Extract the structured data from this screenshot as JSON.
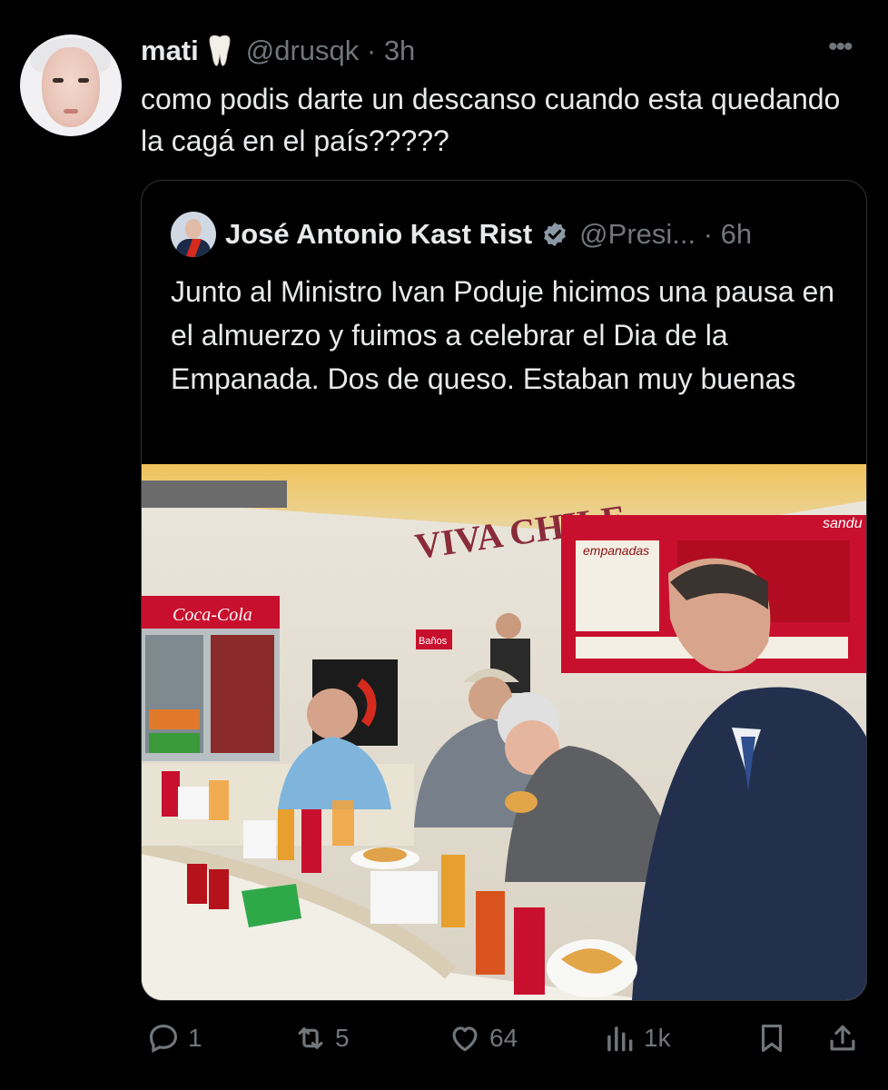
{
  "post": {
    "author_name": "mati",
    "author_emoji_icon": "tooth-icon",
    "handle_time": "@drusqk · 3h",
    "text": "como podis darte un descanso cuando esta quedando la cagá en el país?????"
  },
  "quoted_post": {
    "author_name": "José Antonio Kast Rist",
    "verified_icon": "verified-badge-icon",
    "handle_time": "@Presi... · 6h",
    "text": "Junto al Ministro Ivan Poduje hicimos una pausa en el almuerzo y fuimos a celebrar el Dia de la Empanada. Dos de queso. Estaban muy buenas"
  },
  "photo": {
    "banner_text": "VIVA CHILE",
    "fridge_brand": "Coca-Cola",
    "sign_banos": "Baños",
    "menu_title_left": "empanadas",
    "menu_title_right": "sandu"
  },
  "actions": {
    "replies": "1",
    "reposts": "5",
    "likes": "64",
    "views": "1k"
  },
  "colors": {
    "background": "#000000",
    "text": "#e7e9ea",
    "muted": "#71767b",
    "border": "#2f3336",
    "verified": "#8b98a5"
  }
}
